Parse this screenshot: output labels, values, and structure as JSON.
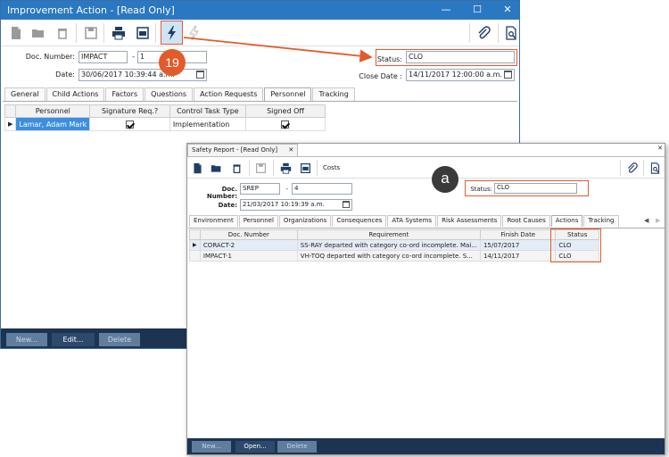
{
  "win1": {
    "title": "Improvement Action - [Read Only]",
    "doc_number_label": "Doc. Number:",
    "doc_number": "IMPACT",
    "doc_sep": "-",
    "doc_rev": "1",
    "date_label": "Date:",
    "date": "30/06/2017 10:39:44 a.m.",
    "status_label": "Status:",
    "status": "CLO",
    "close_date_label": "Close Date :",
    "close_date": "14/11/2017 12:00:00 a.m.",
    "tabs": [
      "General",
      "Child Actions",
      "Factors",
      "Questions",
      "Action Requests",
      "Personnel",
      "Tracking"
    ],
    "grid_headers": [
      "Personnel",
      "Signature Req.?",
      "Control Task Type",
      "Signed Off"
    ],
    "grid_row": {
      "personnel": "Lamar, Adam Mark",
      "control_task_type": "Implementation"
    },
    "buttons": {
      "new": "New...",
      "edit": "Edit...",
      "delete": "Delete"
    }
  },
  "callout_19": "19",
  "callout_a": "a",
  "win2": {
    "title": "Safety Report - [Read Only]",
    "close_x": "✕",
    "costs": "Costs",
    "doc_number_label": "Doc. Number:",
    "doc_number": "SREP",
    "doc_sep": "-",
    "doc_rev": "4",
    "date_label": "Date:",
    "date": "21/03/2017 10:19:39 a.m.",
    "status_label": "Status:",
    "status": "CLO",
    "tabs": [
      "Environment",
      "Personnel",
      "Organizations",
      "Consequences",
      "ATA Systems",
      "Risk Assessments",
      "Root Causes",
      "Actions",
      "Tracking"
    ],
    "grid_headers": [
      "Doc. Number",
      "Requirement",
      "Finish Date",
      "Status"
    ],
    "rows": [
      {
        "doc": "CORACT-2",
        "req": "SS-RAY departed with category co-ord incomplete. Mai...",
        "date": "15/07/2017",
        "status": "CLO"
      },
      {
        "doc": "IMPACT-1",
        "req": "VH-TOQ departed with category co-ord incomplete. S...",
        "date": "14/11/2017",
        "status": "CLO"
      }
    ],
    "buttons": {
      "new": "New...",
      "open": "Open...",
      "delete": "Delete"
    }
  },
  "colors": {
    "titlebar": "#2b78c2",
    "highlight": "#e35b2b",
    "selected_row": "#3b8fe0"
  }
}
